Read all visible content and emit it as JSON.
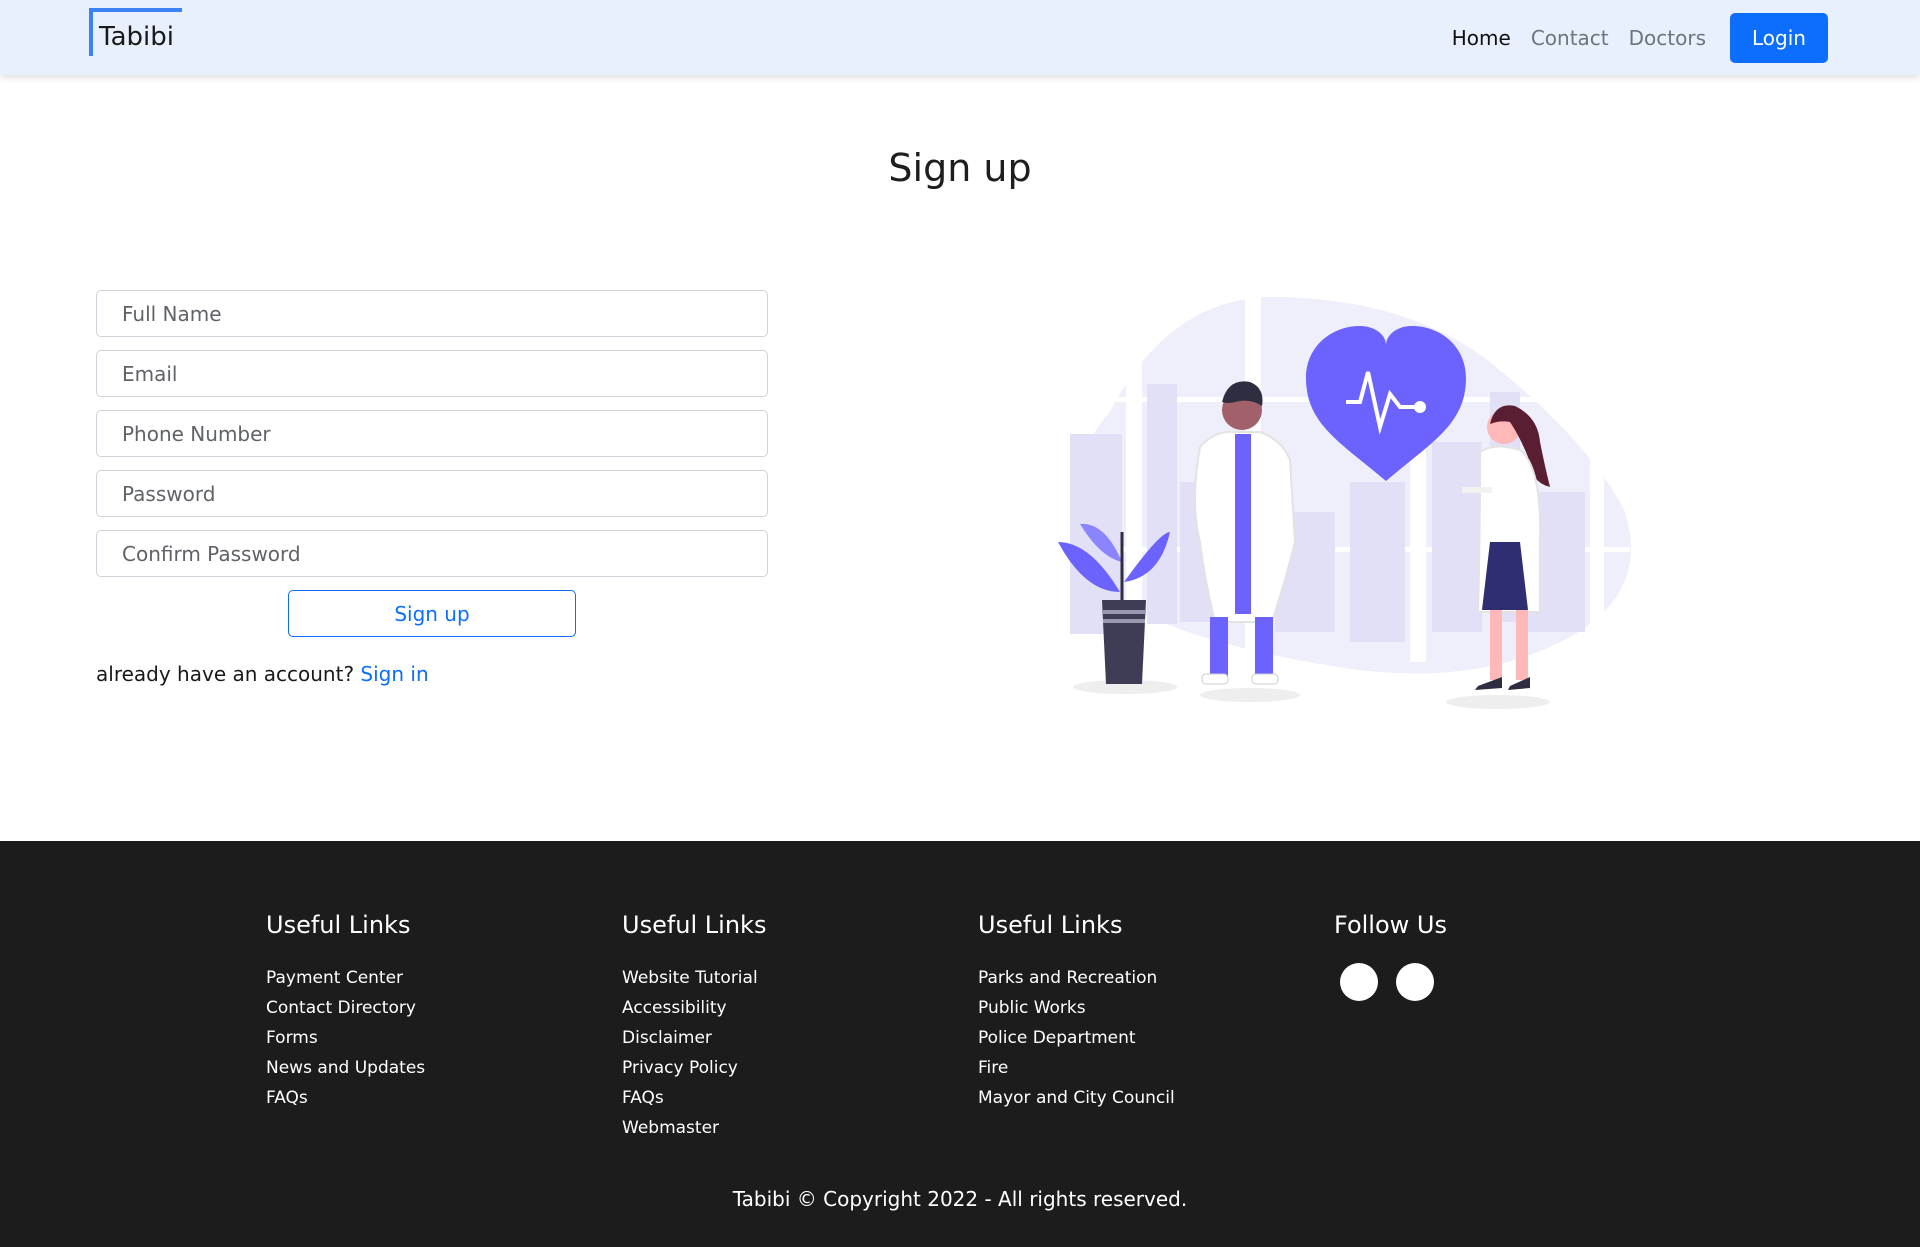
{
  "nav": {
    "brand": "Tabibi",
    "links": [
      {
        "label": "Home"
      },
      {
        "label": "Contact"
      },
      {
        "label": "Doctors"
      }
    ],
    "login_label": "Login"
  },
  "page": {
    "title": "Sign up"
  },
  "form": {
    "full_name_placeholder": "Full Name",
    "email_placeholder": "Email",
    "phone_placeholder": "Phone Number",
    "password_placeholder": "Password",
    "confirm_password_placeholder": "Confirm Password",
    "submit_label": "Sign up",
    "have_account_text": "already have an account?",
    "signin_label": "Sign in"
  },
  "colors": {
    "accent": "#0d6efd",
    "illustration_purple": "#6c63ff",
    "navbar_bg": "#e8f0fe",
    "footer_bg": "#1c1c1c"
  },
  "footer": {
    "columns": [
      {
        "title": "Useful Links",
        "links": [
          "Payment Center",
          "Contact Directory",
          "Forms",
          "News and Updates",
          "FAQs"
        ]
      },
      {
        "title": "Useful Links",
        "links": [
          "Website Tutorial",
          "Accessibility",
          "Disclaimer",
          "Privacy Policy",
          "FAQs",
          "Webmaster"
        ]
      },
      {
        "title": "Useful Links",
        "links": [
          "Parks and Recreation",
          "Public Works",
          "Police Department",
          "Fire",
          "Mayor and City Council"
        ]
      }
    ],
    "follow_title": "Follow Us",
    "social_icons": [
      "social-icon",
      "social-icon"
    ],
    "copyright": "Tabibi © Copyright 2022 - All rights reserved."
  }
}
